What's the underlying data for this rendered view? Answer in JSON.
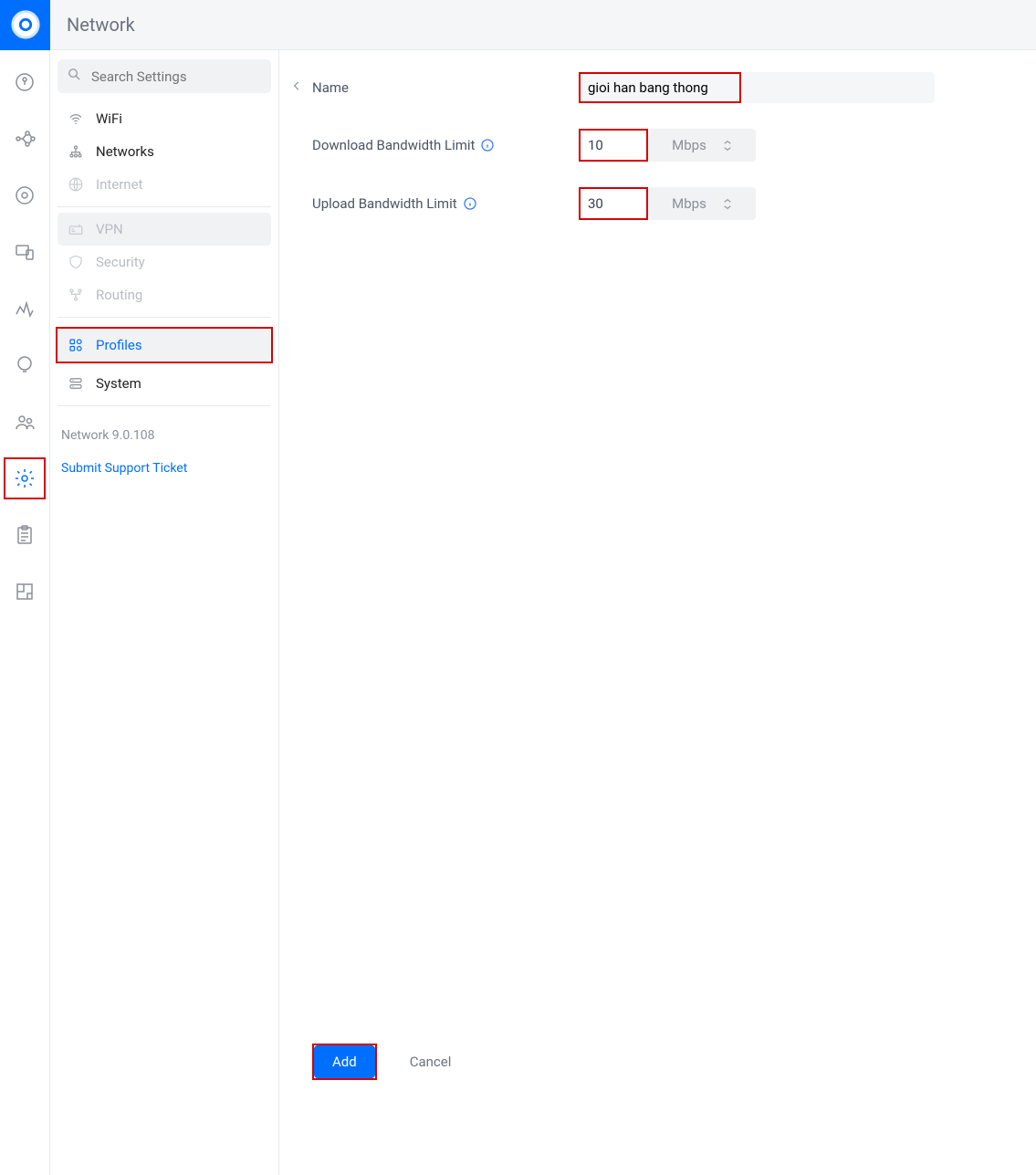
{
  "topbar": {
    "title": "Network"
  },
  "search": {
    "placeholder": "Search Settings"
  },
  "menu": {
    "wifi": "WiFi",
    "networks": "Networks",
    "internet": "Internet",
    "vpn": "VPN",
    "security": "Security",
    "routing": "Routing",
    "profiles": "Profiles",
    "system": "System"
  },
  "footer": {
    "version": "Network 9.0.108",
    "ticket": "Submit Support Ticket"
  },
  "form": {
    "name_label": "Name",
    "name_value": "gioi han bang thong",
    "download_label": "Download Bandwidth Limit",
    "download_value": "10",
    "upload_label": "Upload Bandwidth Limit",
    "upload_value": "30",
    "unit": "Mbps"
  },
  "actions": {
    "add": "Add",
    "cancel": "Cancel"
  }
}
